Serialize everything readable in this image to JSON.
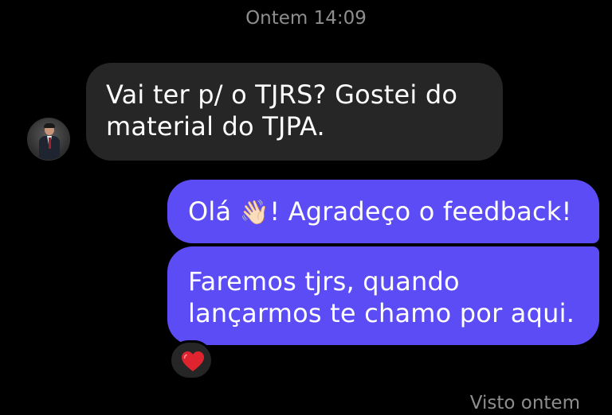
{
  "thread": {
    "timestamp": "Ontem 14:09",
    "seen_status": "Visto ontem"
  },
  "messages": [
    {
      "direction": "incoming",
      "lines": [
        "Vai ter p/ o TJRS? Gostei do",
        "material do TJPA."
      ]
    },
    {
      "direction": "outgoing",
      "before_emoji": "Olá ",
      "emoji": "👋🏻",
      "after_emoji": "! Agradeço o feedback!"
    },
    {
      "direction": "outgoing",
      "lines": [
        "Faremos tjrs, quando",
        "lançarmos te chamo por aqui."
      ],
      "reaction": "heart-icon"
    }
  ],
  "colors": {
    "background": "#000000",
    "incoming_bubble": "#262626",
    "outgoing_bubble": "#5b4cf5",
    "meta_text": "#8e8e8e",
    "reaction_heart": "#e0242f"
  }
}
